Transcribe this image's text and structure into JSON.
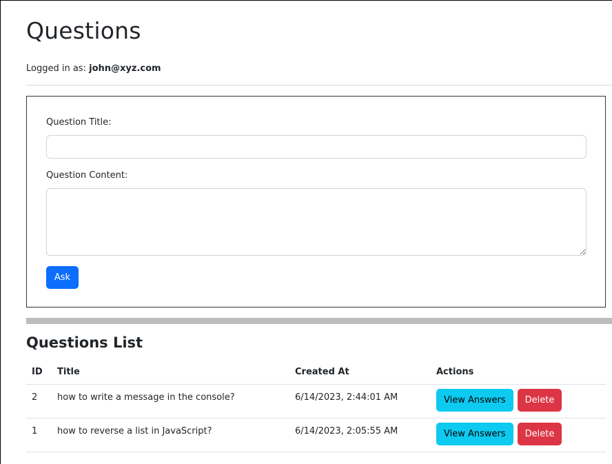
{
  "header": {
    "title": "Questions",
    "logged_in_label": "Logged in as:",
    "logged_in_user": "john@xyz.com"
  },
  "form": {
    "title_label": "Question Title:",
    "title_value": "",
    "content_label": "Question Content:",
    "content_value": "",
    "submit_label": "Ask"
  },
  "list": {
    "heading": "Questions List",
    "columns": [
      "ID",
      "Title",
      "Created At",
      "Actions"
    ],
    "rows": [
      {
        "id": "2",
        "title": "how to write a message in the console?",
        "created_at": "6/14/2023, 2:44:01 AM"
      },
      {
        "id": "1",
        "title": "how to reverse a list in JavaScript?",
        "created_at": "6/14/2023, 2:05:55 AM"
      }
    ],
    "view_label": "View Answers",
    "delete_label": "Delete"
  },
  "colors": {
    "primary": "#0d6efd",
    "info": "#0dcaf0",
    "danger": "#dc3545"
  }
}
